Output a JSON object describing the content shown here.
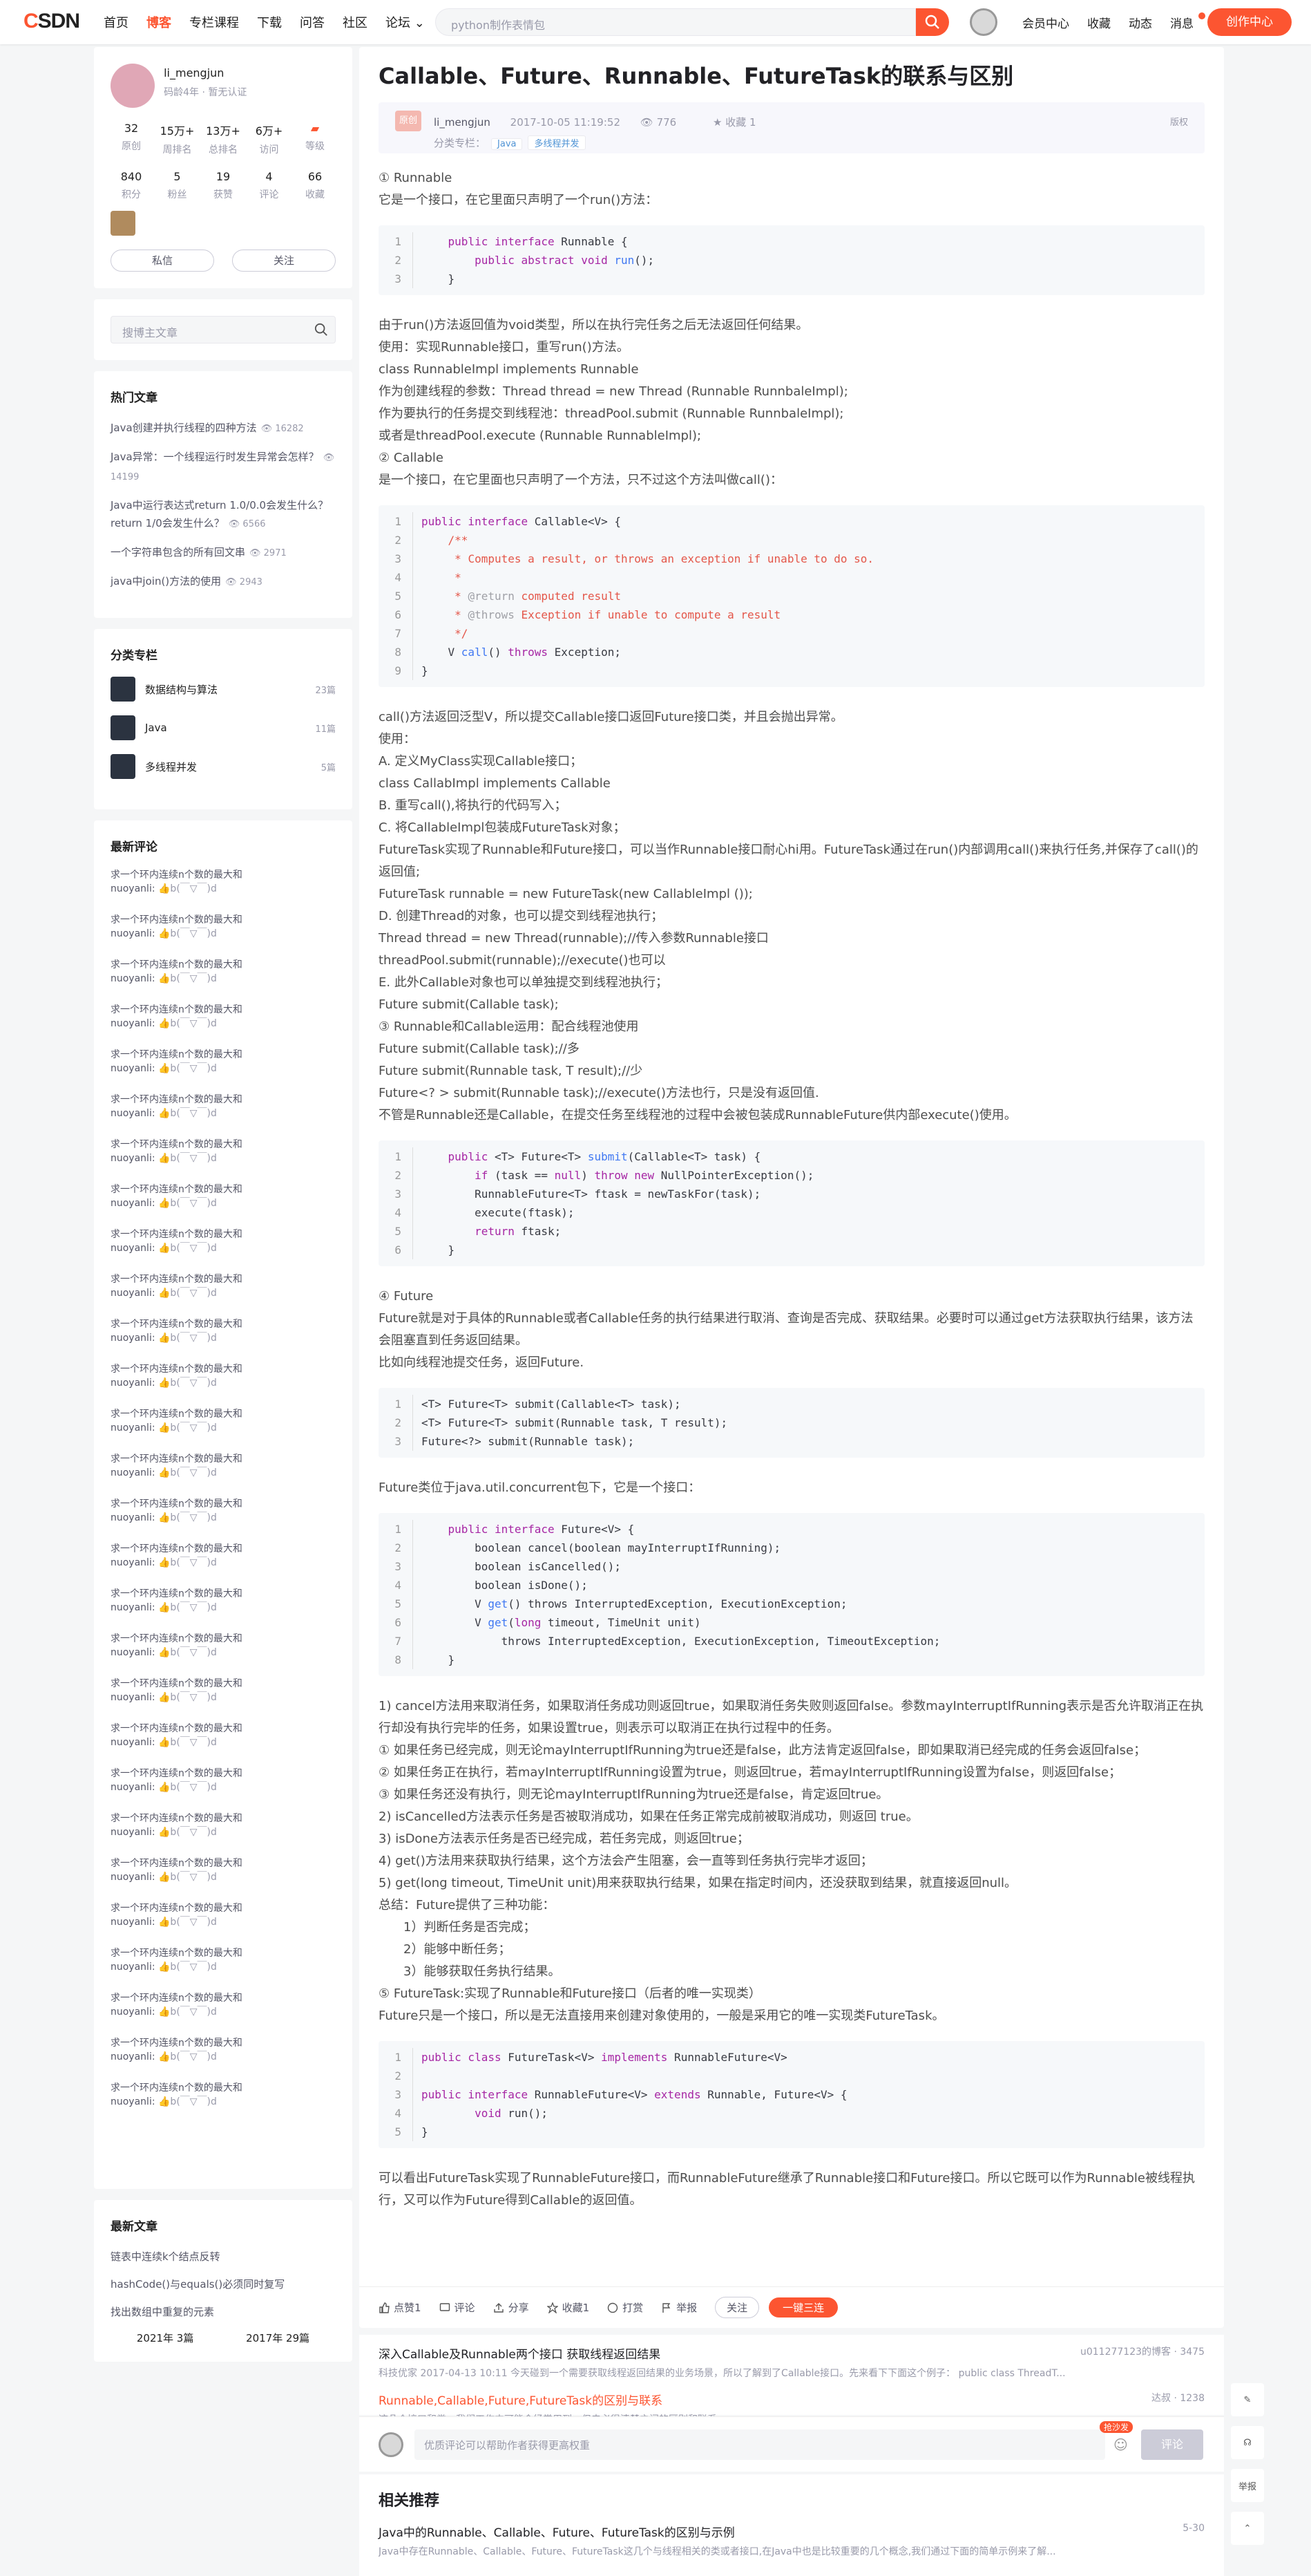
{
  "topbar": {
    "logo_a": "C",
    "logo_b": "SDN",
    "nav": [
      "首页",
      "博客",
      "专栏课程",
      "下载",
      "问答",
      "社区",
      "论坛 ⌄"
    ],
    "search_placeholder": "python制作表情包",
    "links": [
      "会员中心",
      "收藏",
      "动态",
      "消息"
    ],
    "create": "创作中心"
  },
  "profile": {
    "name": "li_mengjun",
    "sub": "码龄4年 · 暂无认证",
    "stats1": [
      {
        "v": "32",
        "l": "原创"
      },
      {
        "v": "15万+",
        "l": "周排名"
      },
      {
        "v": "13万+",
        "l": "总排名"
      },
      {
        "v": "6万+",
        "l": "访问"
      },
      {
        "v": "",
        "l": "等级"
      }
    ],
    "stats2": [
      {
        "v": "840",
        "l": "积分"
      },
      {
        "v": "5",
        "l": "粉丝"
      },
      {
        "v": "19",
        "l": "获赞"
      },
      {
        "v": "4",
        "l": "评论"
      },
      {
        "v": "66",
        "l": "收藏"
      }
    ],
    "btn_msg": "私信",
    "btn_follow": "关注"
  },
  "side_search": "搜博主文章",
  "hot": {
    "title": "热门文章",
    "items": [
      {
        "t": "Java创建并执行线程的四种方法",
        "c": "16282"
      },
      {
        "t": "Java异常：一个线程运行时发生异常会怎样？",
        "c": "14199"
      },
      {
        "t": "Java中运行表达式return 1.0/0.0会发生什么？ return 1/0会发生什么？",
        "c": "6566"
      },
      {
        "t": "一个字符串包含的所有回文串",
        "c": "2971"
      },
      {
        "t": "java中join()方法的使用",
        "c": "2943"
      }
    ]
  },
  "columns": {
    "title": "分类专栏",
    "items": [
      {
        "t": "数据结构与算法",
        "c": "23篇"
      },
      {
        "t": "Java",
        "c": "11篇"
      },
      {
        "t": "多线程并发",
        "c": "5篇"
      }
    ]
  },
  "latest_comments": {
    "title": "最新评论",
    "t": "求一个环内连续n个数的最大和",
    "u": "nuoyanli:",
    "c": "👍b(￣▽￣)d"
  },
  "latest_articles": {
    "title": "最新文章",
    "items": [
      "链表中连续k个结点反转",
      "hashCode()与equals()必须同时复写",
      "找出数组中重复的元素"
    ],
    "years": [
      "2021年 3篇",
      "2017年 29篇"
    ]
  },
  "article": {
    "title": "Callable、Future、Runnable、FutureTask的联系与区别",
    "orig": "原创",
    "author": "li_mengjun",
    "date": "2017-10-05 11:19:52",
    "views": "776",
    "fav": "收藏 1",
    "copyright": "版权",
    "col_label": "分类专栏：",
    "tags": [
      "Java",
      "多线程并发"
    ]
  },
  "toolbar": {
    "like": "点赞1",
    "comment": "评论",
    "share": "分享",
    "fav": "收藏1",
    "tip": "打赏",
    "report": "举报",
    "follow": "关注",
    "triple": "一键三连"
  },
  "recs": [
    {
      "t": "深入Callable及Runnable两个接口 获取线程返回结果",
      "r": "u011277123的博客 · 3475",
      "d": "科技优家 2017-04-13 10:11 今天碰到一个需要获取线程返回结果的业务场景，所以了解到了Callable接口。先来看下下面这个例子： public class ThreadT..."
    },
    {
      "t": "Runnable,Callable,Future,FutureTask的区别与联系",
      "r": "达叔 · 1238",
      "d": "这几个接口和类，我们工作中可能会经常用到，但未必很清楚之间的区别和联系~"
    }
  ],
  "comment": {
    "placeholder": "优质评论可以帮助作者获得更高权重",
    "btn": "评论",
    "badge": "抢沙发"
  },
  "related": {
    "title": "相关推荐",
    "t": "Java中的Runnable、Callable、Future、FutureTask的区别与示例",
    "date": "5-30",
    "d": "Java中存在Runnable、Callable、Future、FutureTask这几个与线程相关的类或者接口,在Java中也是比较重要的几个概念,我们通过下面的简单示例来了解..."
  },
  "float_tools": [
    "✎",
    "☊",
    "举报",
    "⌃"
  ]
}
